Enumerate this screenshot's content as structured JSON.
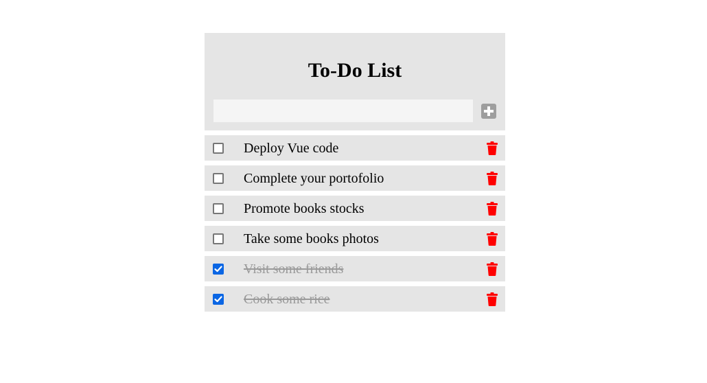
{
  "app": {
    "title": "To-Do List",
    "new_todo": {
      "value": "",
      "placeholder": ""
    },
    "add_icon": "plus-square-icon",
    "delete_icon": "trash-icon",
    "colors": {
      "panel": "#e5e5e5",
      "input": "#f5f5f5",
      "add_button": "#9e9e9e",
      "delete": "#ff0000",
      "checked": "#0b66e4",
      "done_text": "#9a9a9a"
    }
  },
  "todos": [
    {
      "label": "Deploy Vue code",
      "done": false
    },
    {
      "label": "Complete your portofolio",
      "done": false
    },
    {
      "label": "Promote books stocks",
      "done": false
    },
    {
      "label": "Take some books photos",
      "done": false
    },
    {
      "label": "Visit some friends",
      "done": true
    },
    {
      "label": "Cook some rice",
      "done": true
    }
  ]
}
